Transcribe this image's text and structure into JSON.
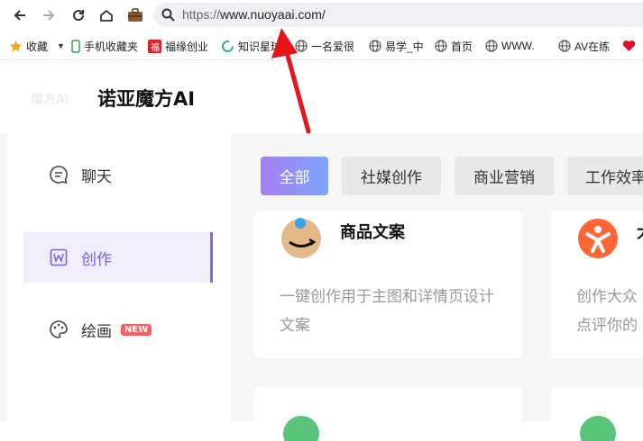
{
  "browser": {
    "url_scheme": "https://",
    "url_host": "www.nuoyaai.com/",
    "icons": {
      "back": "back-arrow-icon",
      "forward": "forward-arrow-icon",
      "reload": "reload-icon",
      "home": "home-icon",
      "extension": "briefcase-icon",
      "search": "search-icon"
    }
  },
  "bookmarks": [
    {
      "label": "收藏",
      "icon": "star-icon"
    },
    {
      "label": "手机收藏夹",
      "icon": "phone-icon"
    },
    {
      "label": "福缘创业",
      "icon": "site-favicon"
    },
    {
      "label": "知识星球",
      "icon": "planet-icon"
    },
    {
      "label": "一名爱很",
      "icon": "globe-icon"
    },
    {
      "label": "易学_中",
      "icon": "globe-icon"
    },
    {
      "label": "首页",
      "icon": "globe-icon"
    },
    {
      "label": "WWW.",
      "icon": "globe-icon"
    },
    {
      "label": "AV在练",
      "icon": "globe-icon"
    }
  ],
  "header": {
    "ghost_title": "魔方AI",
    "logo_text": "诺亚魔方AI"
  },
  "sidebar": {
    "items": [
      {
        "label": "聊天",
        "icon": "chat-bubble-icon"
      },
      {
        "label": "创作",
        "icon": "write-icon"
      },
      {
        "label": "绘画",
        "icon": "palette-icon",
        "badge": "NEW"
      }
    ]
  },
  "tabs": [
    {
      "label": "全部"
    },
    {
      "label": "社媒创作"
    },
    {
      "label": "商业营销"
    },
    {
      "label": "工作效率"
    }
  ],
  "cards": [
    {
      "title": "商品文案",
      "desc": "一键创作用于主图和详情页设计文案",
      "icon": "amazon-logo-icon"
    },
    {
      "title": "大",
      "desc": "创作大众点评你的评论要",
      "icon": "dianping-logo-icon"
    }
  ],
  "colors": {
    "accent": "#8a63f2",
    "arrow": "#e8141b",
    "badge": "#ff5c5c"
  }
}
